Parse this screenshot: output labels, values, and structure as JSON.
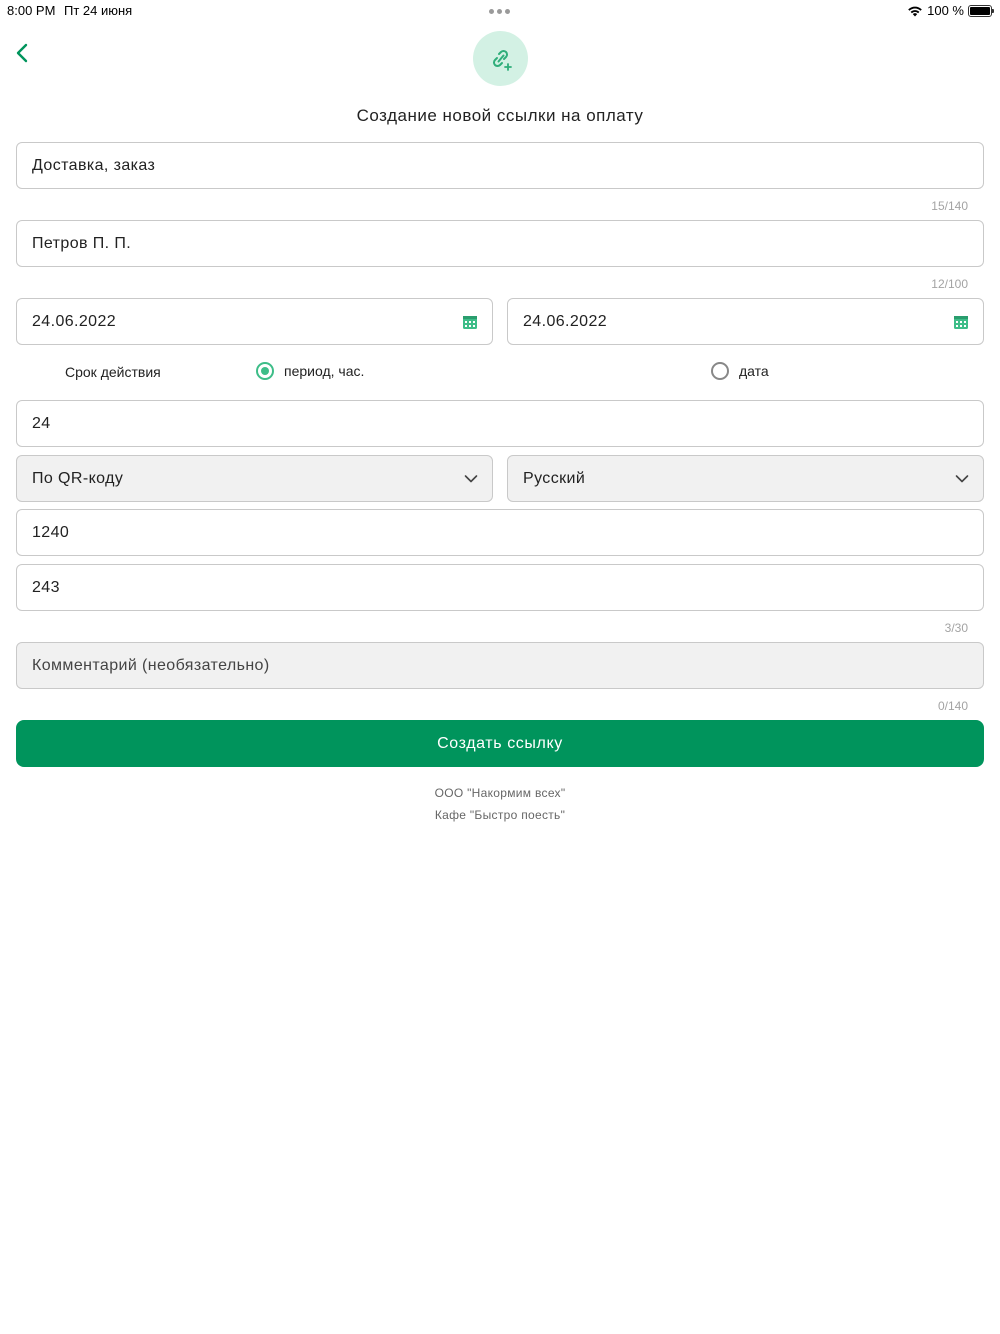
{
  "status_bar": {
    "time": "8:00 PM",
    "date": "Пт 24 июня",
    "battery": "100 %"
  },
  "header": {
    "title": "Создание новой ссылки на оплату"
  },
  "form": {
    "purpose": {
      "value": "Доставка, заказ",
      "counter": "15/140"
    },
    "customer": {
      "value": "Петров П. П.",
      "counter": "12/100"
    },
    "date_from": {
      "value": "24.06.2022"
    },
    "date_to": {
      "value": "24.06.2022"
    },
    "validity": {
      "label": "Срок действия",
      "option_period": "период, час.",
      "option_date": "дата",
      "selected": "period"
    },
    "hours": {
      "value": "24"
    },
    "payment_method": {
      "value": "По QR-коду"
    },
    "language": {
      "value": "Русский"
    },
    "amount": {
      "value": "1240"
    },
    "order_number": {
      "value": "243",
      "counter": "3/30"
    },
    "comment": {
      "placeholder": "Комментарий (необязательно)",
      "counter": "0/140"
    }
  },
  "actions": {
    "create_label": "Создать ссылку"
  },
  "footer": {
    "company": "ООО \"Накормим всех\"",
    "store": "Кафе \"Быстро поесть\""
  },
  "colors": {
    "accent": "#00945c",
    "accent_light": "#d3f1e4",
    "radio_active": "#3dbd88"
  }
}
